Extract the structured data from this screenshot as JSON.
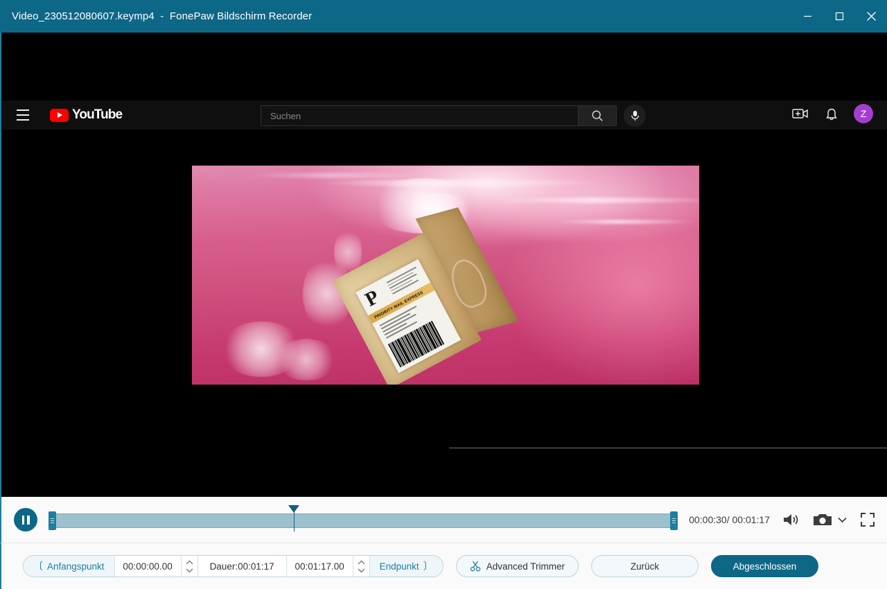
{
  "window": {
    "file_name": "Video_230512080607.keymp4",
    "separator": "-",
    "app_name": "FonePaw Bildschirm Recorder",
    "title_full": "Video_230512080607.keymp4  -  FonePaw Bildschirm Recorder",
    "controls": {
      "minimize": "minimize-button",
      "maximize": "maximize-button",
      "close": "close-button"
    },
    "accent_color": "#0d6787",
    "border_color": "#1d7fa0"
  },
  "video": {
    "youtube": {
      "wordmark": "YouTube",
      "search_placeholder": "Suchen",
      "avatar_initial": "Z",
      "icons": {
        "menu": "hamburger-icon",
        "search": "search-icon",
        "mic": "microphone-icon",
        "create": "create-video-icon",
        "notifications": "bell-icon"
      }
    },
    "overlay_glyph_left": "circle-monogram-icon",
    "overlay_glyph_right": "sm-monogram-icon",
    "scene_label": {
      "logo_letter": "P",
      "service": "PRIORITY MAIL EXPRESS"
    },
    "background_color": "#000000",
    "water_color": "#cf4f7e"
  },
  "player": {
    "play_pause": "pause-button",
    "current_time": "00:00:30",
    "total_time": "00:01:17",
    "time_display": "00:00:30/ 00:01:17",
    "playhead_percent": 39,
    "selection_start_percent": 0,
    "selection_end_percent": 100,
    "icons": {
      "volume": "volume-icon",
      "snapshot": "camera-icon",
      "snapshot_menu": "chevron-down-icon",
      "fullscreen": "fullscreen-icon"
    }
  },
  "trim": {
    "start_label": "Anfangspunkt",
    "start_bracket": "〔",
    "start_value": "00:00:00.00",
    "duration_label": "Dauer:00:01:17",
    "end_value": "00:01:17.00",
    "end_label": "Endpunkt",
    "end_bracket": "〕",
    "advanced_trimmer": "Advanced Trimmer",
    "scissors_icon": "scissors-icon",
    "spinner_up": "chevron-up-icon",
    "spinner_down": "chevron-down-icon"
  },
  "actions": {
    "back": "Zurück",
    "done": "Abgeschlossen"
  }
}
